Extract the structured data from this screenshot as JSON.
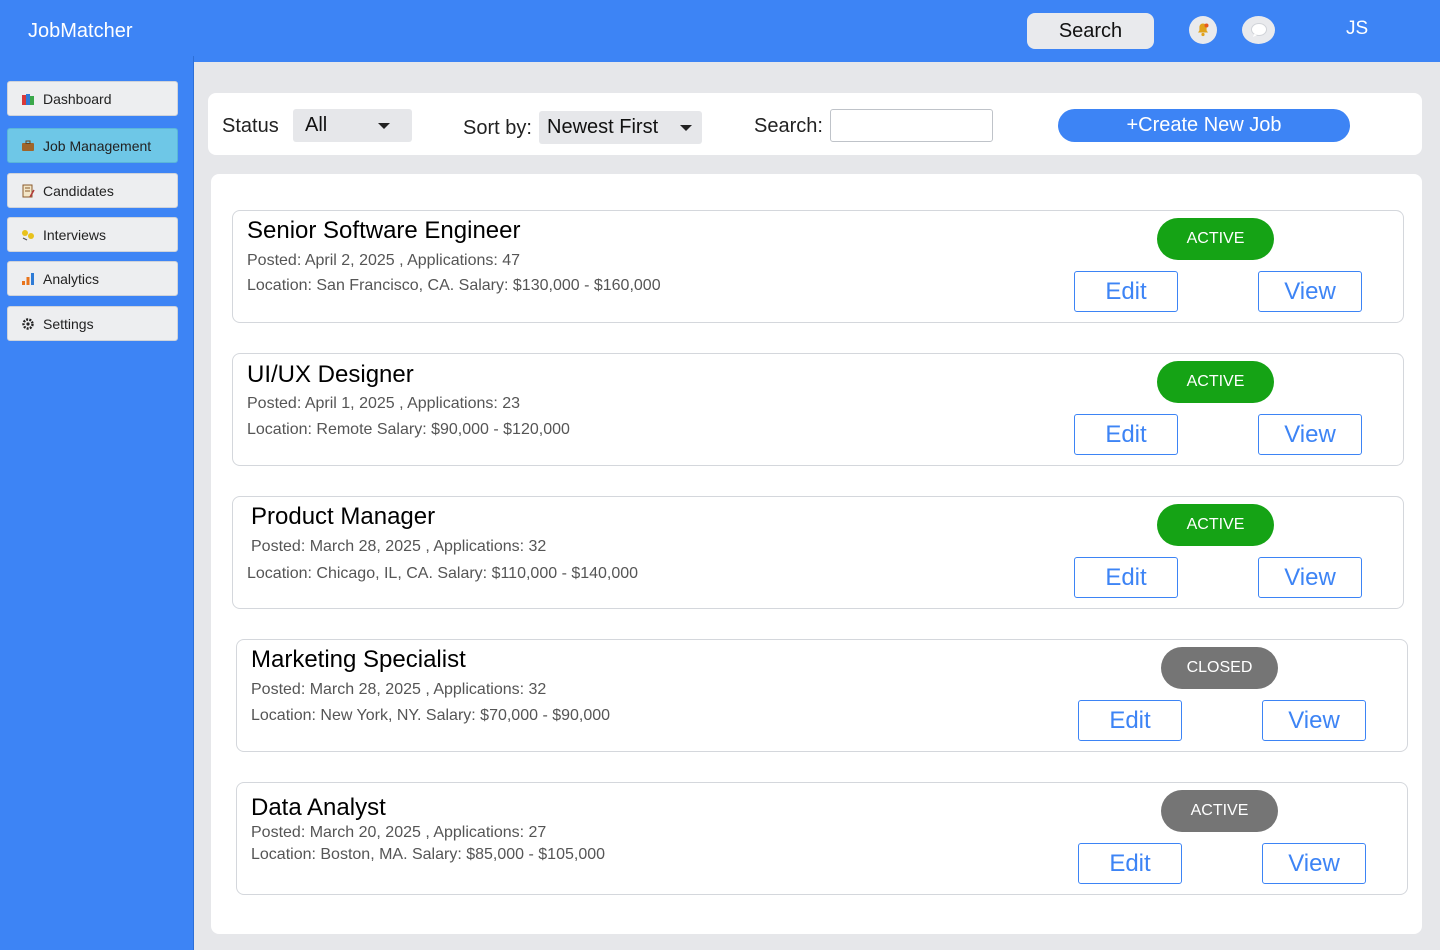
{
  "header": {
    "app_title": "JobMatcher",
    "search_label": "Search",
    "avatar_initials": "JS",
    "bell_icon": "bell-icon",
    "chat_icon": "chat-bubble-icon",
    "bar_color": "#3d84f5"
  },
  "sidebar": {
    "items": [
      {
        "label": "Dashboard",
        "icon": "books-icon"
      },
      {
        "label": "Job Management",
        "icon": "briefcase-icon",
        "active": true
      },
      {
        "label": "Candidates",
        "icon": "notepad-icon"
      },
      {
        "label": "Interviews",
        "icon": "people-icon"
      },
      {
        "label": "Analytics",
        "icon": "bar-chart-icon"
      },
      {
        "label": "Settings",
        "icon": "gear-icon"
      }
    ]
  },
  "filters": {
    "status_label": "Status",
    "status_value": "All",
    "sort_label": "Sort by:",
    "sort_value": "Newest First",
    "search_label": "Search:",
    "search_value": "",
    "create_label": "+Create New Job"
  },
  "jobs": [
    {
      "title": "Senior Software Engineer",
      "posted": "Posted: April 2, 2025 , Applications: 47",
      "details": "Location: San Francisco, CA.  Salary: $130,000 - $160,000",
      "status": "ACTIVE",
      "status_color": "#15a315",
      "edit": "Edit",
      "view": "View"
    },
    {
      "title": "UI/UX Designer",
      "posted": "Posted: April 1, 2025 , Applications: 23",
      "details": "Location: Remote  Salary: $90,000 - $120,000",
      "status": "ACTIVE",
      "status_color": "#15a315",
      "edit": "Edit",
      "view": "View"
    },
    {
      "title": "Product Manager",
      "posted": "Posted: March 28, 2025 , Applications: 32",
      "details": "Location: Chicago, IL, CA.  Salary: $110,000 - $140,000",
      "status": "ACTIVE",
      "status_color": "#15a315",
      "edit": "Edit",
      "view": "View"
    },
    {
      "title": "Marketing Specialist",
      "posted": "Posted: March 28, 2025 , Applications: 32",
      "details": "Location: New York, NY.  Salary: $70,000 - $90,000",
      "status": "CLOSED",
      "status_color": "#757575",
      "edit": "Edit",
      "view": "View"
    },
    {
      "title": "Data Analyst",
      "posted": "Posted: March 20, 2025 , Applications: 27",
      "details": "Location: Boston, MA.  Salary: $85,000 - $105,000",
      "status": "ACTIVE",
      "status_color": "#757575",
      "edit": "Edit",
      "view": "View"
    }
  ]
}
